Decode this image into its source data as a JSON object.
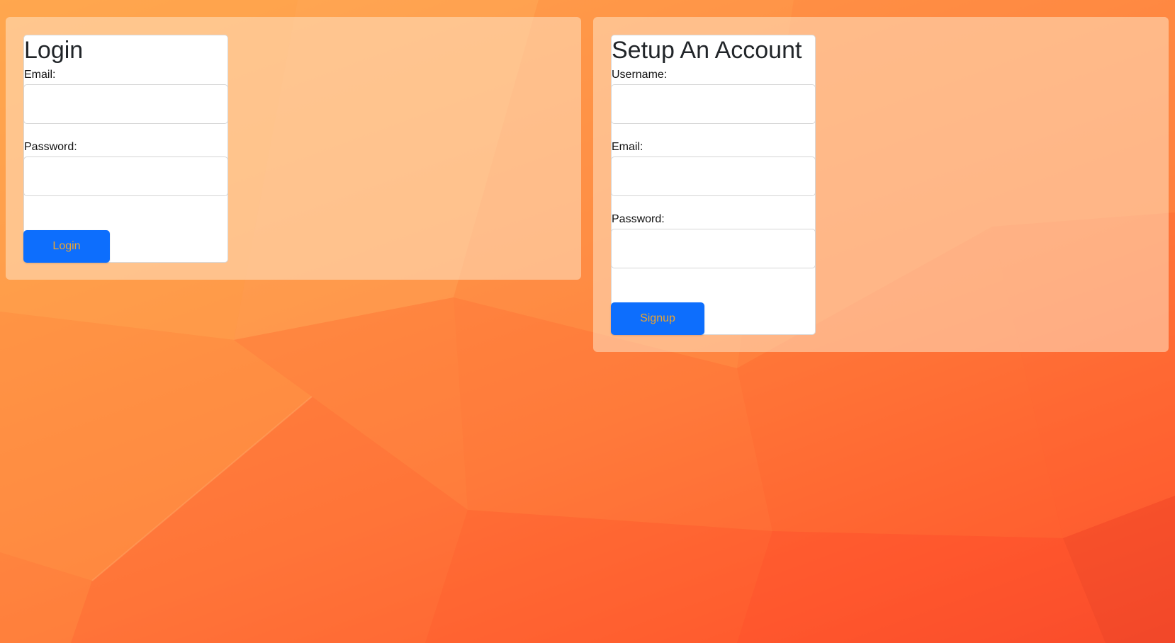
{
  "login": {
    "title": "Login",
    "email_label": "Email:",
    "password_label": "Password:",
    "email_value": "",
    "password_value": "",
    "button_label": "Login"
  },
  "signup": {
    "title": "Setup An Account",
    "username_label": "Username:",
    "email_label": "Email:",
    "password_label": "Password:",
    "username_value": "",
    "email_value": "",
    "password_value": "",
    "button_label": "Signup"
  },
  "colors": {
    "button_bg": "#0d6efd",
    "button_text": "#f0a52c",
    "background": "#ff7a3a"
  }
}
